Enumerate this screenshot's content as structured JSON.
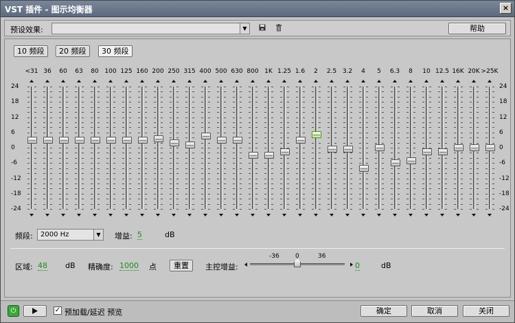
{
  "window": {
    "title": "VST 插件 - 图示均衡器",
    "close_label": "×"
  },
  "toolbar": {
    "preset_label": "预设效果:",
    "preset_value": "",
    "save_icon": "floppy-icon",
    "delete_icon": "trash-icon",
    "help_label": "帮助"
  },
  "band_modes": [
    {
      "label": "10 频段",
      "active": false
    },
    {
      "label": "20 频段",
      "active": false
    },
    {
      "label": "30 频段",
      "active": true
    }
  ],
  "scale": [
    "24",
    "18",
    "12",
    "6",
    "0",
    "-6",
    "-12",
    "-18",
    "-24"
  ],
  "scale_range": [
    -24,
    24
  ],
  "bands": [
    {
      "freq": "<31",
      "gain": 3
    },
    {
      "freq": "36",
      "gain": 3
    },
    {
      "freq": "60",
      "gain": 3
    },
    {
      "freq": "63",
      "gain": 3
    },
    {
      "freq": "80",
      "gain": 3
    },
    {
      "freq": "100",
      "gain": 3
    },
    {
      "freq": "125",
      "gain": 3
    },
    {
      "freq": "160",
      "gain": 3
    },
    {
      "freq": "200",
      "gain": 3.5
    },
    {
      "freq": "250",
      "gain": 2
    },
    {
      "freq": "315",
      "gain": 1
    },
    {
      "freq": "400",
      "gain": 4.5
    },
    {
      "freq": "500",
      "gain": 3
    },
    {
      "freq": "630",
      "gain": 3
    },
    {
      "freq": "800",
      "gain": -3
    },
    {
      "freq": "1K",
      "gain": -3
    },
    {
      "freq": "1.25",
      "gain": -1.5
    },
    {
      "freq": "1.6",
      "gain": 3
    },
    {
      "freq": "2",
      "gain": 5,
      "selected": true
    },
    {
      "freq": "2.5",
      "gain": -0.5
    },
    {
      "freq": "3.2",
      "gain": -0.5
    },
    {
      "freq": "4",
      "gain": -8
    },
    {
      "freq": "5",
      "gain": 0
    },
    {
      "freq": "6.3",
      "gain": -6
    },
    {
      "freq": "8",
      "gain": -5
    },
    {
      "freq": "10",
      "gain": -1.5
    },
    {
      "freq": "12.5",
      "gain": -1.5
    },
    {
      "freq": "16K",
      "gain": 0
    },
    {
      "freq": "20K",
      "gain": 0
    },
    {
      "freq": ">25K",
      "gain": 0
    }
  ],
  "band_controls": {
    "freq_label": "频段:",
    "freq_value": "2000 Hz",
    "gain_label": "增益:",
    "gain_value": "5",
    "gain_unit": "dB"
  },
  "master": {
    "range_label": "区域:",
    "range_value": "48",
    "range_unit": "dB",
    "precision_label": "精确度:",
    "precision_value": "1000",
    "precision_unit": "点",
    "reset_label": "重置",
    "gain_label": "主控增益:",
    "ticks": [
      "-36",
      "0",
      "36"
    ],
    "gain_value": "0",
    "gain_unit": "dB"
  },
  "footer": {
    "power_icon": "power-icon",
    "play_icon": "play-icon",
    "preroll_checked": true,
    "preroll_label": "预加载/延迟 预览",
    "ok_label": "确定",
    "cancel_label": "取消",
    "close_label": "关闭"
  }
}
